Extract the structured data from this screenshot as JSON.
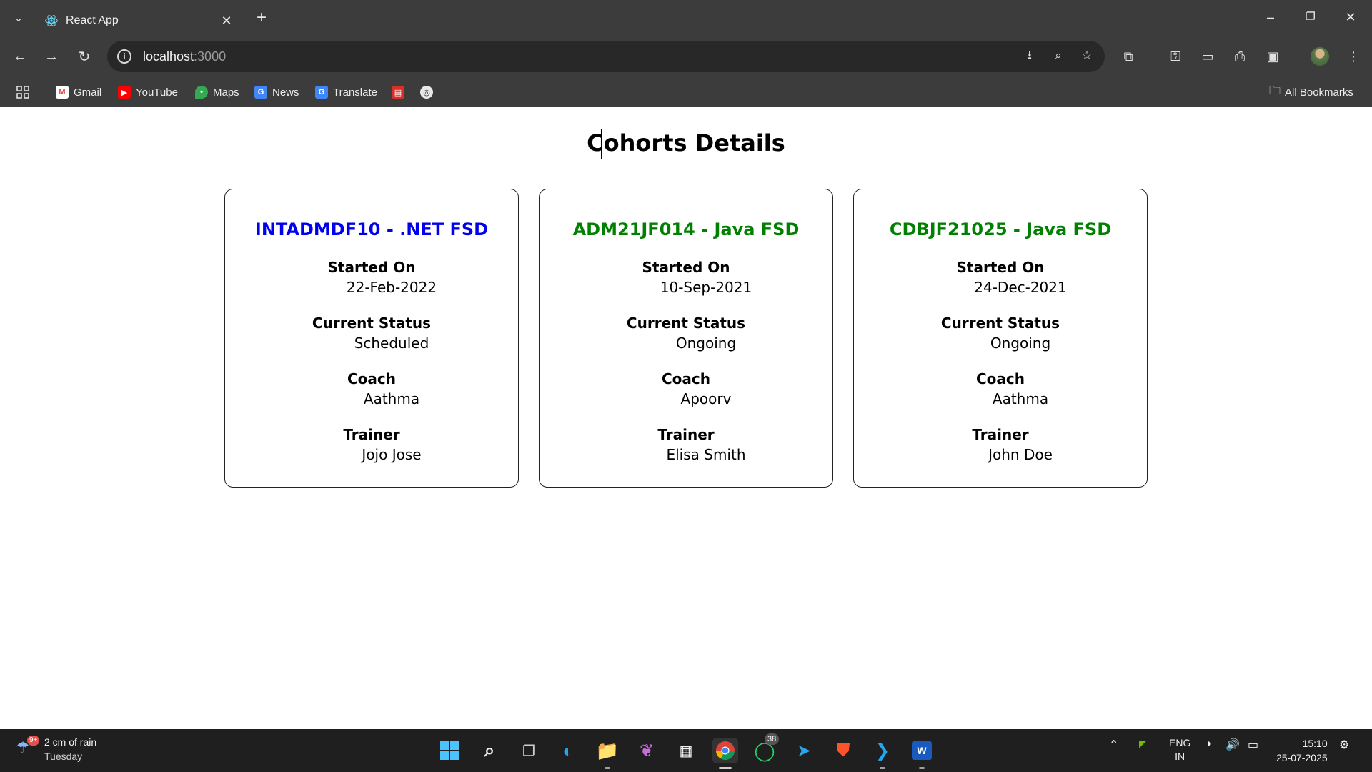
{
  "browser": {
    "tab_title": "React App",
    "url_host": "localhost",
    "url_port": ":3000",
    "bookmarks": [
      {
        "label": "Gmail",
        "icon": "gmail-icon"
      },
      {
        "label": "YouTube",
        "icon": "youtube-icon"
      },
      {
        "label": "Maps",
        "icon": "maps-icon"
      },
      {
        "label": "News",
        "icon": "news-icon"
      },
      {
        "label": "Translate",
        "icon": "translate-icon"
      }
    ],
    "all_bookmarks_label": "All Bookmarks"
  },
  "page": {
    "title": "Cohorts Details",
    "labels": {
      "started_on": "Started On",
      "current_status": "Current Status",
      "coach": "Coach",
      "trainer": "Trainer"
    },
    "cohorts": [
      {
        "title": "INTADMDF10 - .NET FSD",
        "color": "#0000ee",
        "started_on": "22-Feb-2022",
        "status": "Scheduled",
        "coach": "Aathma",
        "trainer": "Jojo Jose"
      },
      {
        "title": "ADM21JF014 - Java FSD",
        "color": "#008000",
        "started_on": "10-Sep-2021",
        "status": "Ongoing",
        "coach": "Apoorv",
        "trainer": "Elisa Smith"
      },
      {
        "title": "CDBJF21025 - Java FSD",
        "color": "#008000",
        "started_on": "24-Dec-2021",
        "status": "Ongoing",
        "coach": "Aathma",
        "trainer": "John Doe"
      }
    ]
  },
  "taskbar": {
    "weather_main": "2 cm of rain",
    "weather_sub": "Tuesday",
    "weather_badge": "9+",
    "whatsapp_badge": "38",
    "lang_1": "ENG",
    "lang_2": "IN",
    "time": "15:10",
    "date": "25-07-2025"
  }
}
